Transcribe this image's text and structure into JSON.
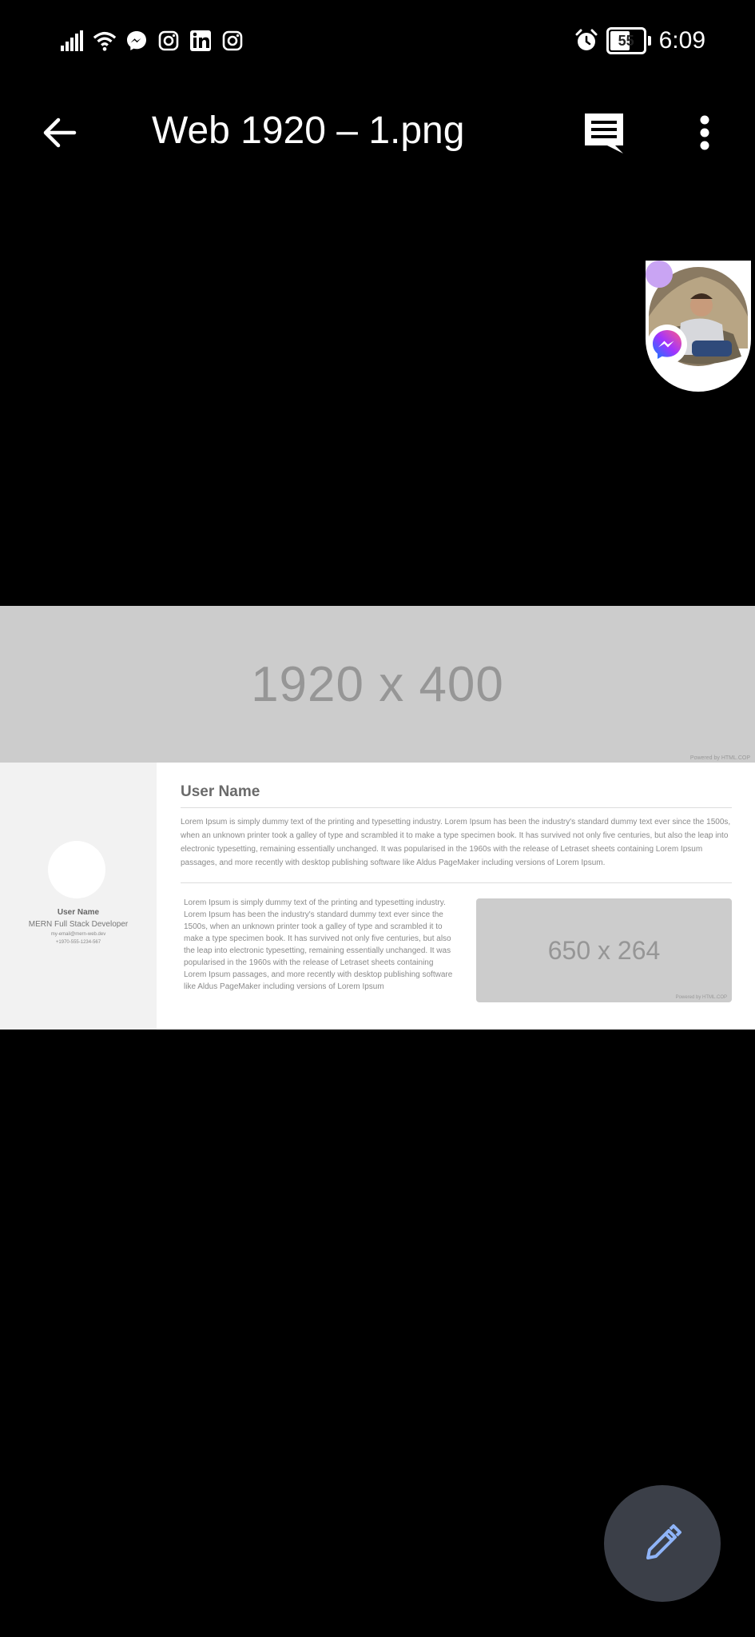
{
  "status_bar": {
    "time": "6:09",
    "battery": "55",
    "left_icons": [
      "signal-icon",
      "wifi-icon",
      "messenger-icon",
      "instagram-icon",
      "linkedin-icon",
      "instagram-icon"
    ],
    "right_icons": [
      "alarm-icon",
      "battery-icon"
    ]
  },
  "app_bar": {
    "title": "Web 1920 – 1.png",
    "back_icon": "arrow-left-icon",
    "comment_icon": "comment-icon",
    "more_icon": "more-vertical-icon"
  },
  "preview": {
    "hero_placeholder": "1920 x 400",
    "hero_powered": "Powered by HTML.COP",
    "sidebar": {
      "name": "User Name",
      "role": "MERN Full Stack Developer",
      "email": "my-email@mern-web.dev",
      "phone": "+1970-555-1234-567"
    },
    "main_name": "User Name",
    "paragraph1": "Lorem Ipsum is simply dummy text of the printing and typesetting industry. Lorem Ipsum has been the industry's standard dummy text ever since the 1500s, when an unknown printer took a galley of type and scrambled it to make a type specimen book. It has survived not only five centuries, but also the leap into electronic typesetting, remaining essentially unchanged. It was popularised in the 1960s with the release of Letraset sheets containing Lorem Ipsum passages, and more recently with desktop publishing software like Aldus PageMaker including versions of Lorem Ipsum.",
    "paragraph2": "Lorem Ipsum is simply dummy text of the printing and typesetting industry. Lorem Ipsum has been the industry's standard dummy text ever since the 1500s, when an unknown printer took a galley of type and scrambled it to make a type specimen book. It has survived not only five centuries, but also the leap into electronic typesetting, remaining essentially unchanged. It was popularised in the 1960s with the release of Letraset sheets containing Lorem Ipsum passages, and more recently with desktop publishing software like Aldus PageMaker including versions of Lorem Ipsum",
    "sub_placeholder": "650 x 264",
    "sub_powered": "Powered by HTML.COP"
  },
  "fab": {
    "icon": "pencil-icon",
    "color": "#3b3f48"
  },
  "chat_head": {
    "dot_color": "#c9a4f3"
  }
}
